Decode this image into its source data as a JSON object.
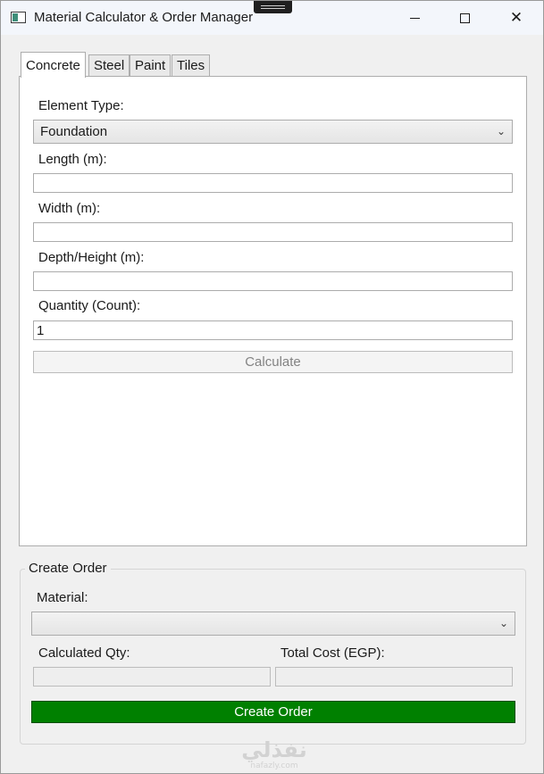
{
  "window": {
    "title": "Material Calculator & Order Manager",
    "close_glyph": "✕"
  },
  "tabs": [
    {
      "label": "Concrete",
      "active": true
    },
    {
      "label": "Steel",
      "active": false
    },
    {
      "label": "Paint",
      "active": false
    },
    {
      "label": "Tiles",
      "active": false
    }
  ],
  "concrete": {
    "element_type_label": "Element Type:",
    "element_type_value": "Foundation",
    "length_label": "Length (m):",
    "length_value": "",
    "width_label": "Width (m):",
    "width_value": "",
    "depth_label": "Depth/Height (m):",
    "depth_value": "",
    "quantity_label": "Quantity (Count):",
    "quantity_value": "1",
    "calculate_label": "Calculate"
  },
  "order": {
    "group_title": "Create Order",
    "material_label": "Material:",
    "material_value": "",
    "calc_qty_label": "Calculated Qty:",
    "calc_qty_value": "",
    "total_cost_label": "Total Cost (EGP):",
    "total_cost_value": "",
    "create_label": "Create Order"
  },
  "watermark": {
    "main": "نفذلي",
    "sub": "nafazly.com"
  },
  "colors": {
    "accent": "#008000",
    "background": "#f0f0f0",
    "panel": "#ffffff"
  },
  "icons": {
    "app": "app-window-icon",
    "minimize": "minimize-icon",
    "maximize": "maximize-icon",
    "close": "close-icon",
    "dropdown": "chevron-down-icon"
  }
}
